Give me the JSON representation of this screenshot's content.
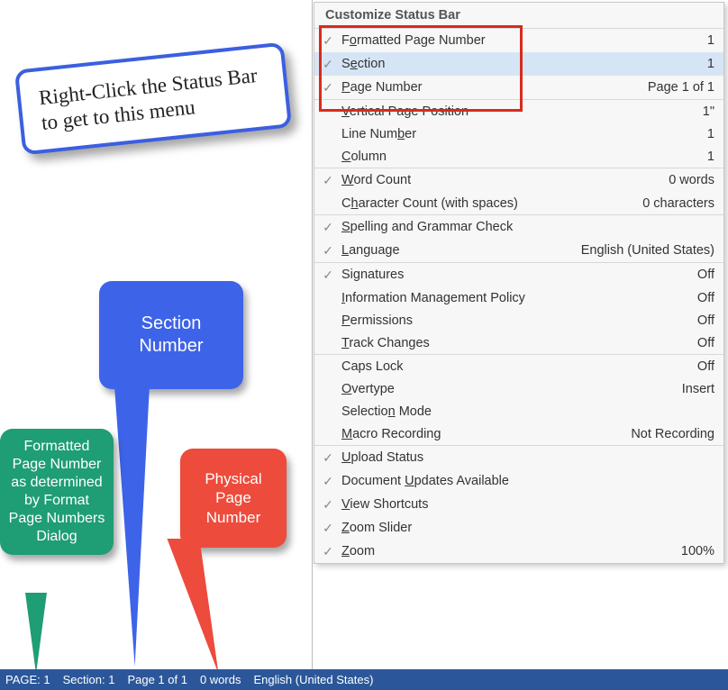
{
  "callout": {
    "note": "Right-Click the Status Bar to get to this menu",
    "blue": "Section Number",
    "green": "Formatted Page Number as determined by Format Page Numbers Dialog",
    "red": "Physical Page Number"
  },
  "menu": {
    "title": "Customize Status Bar",
    "groups": [
      [
        {
          "checked": true,
          "label_pre": "F",
          "label_ul": "o",
          "label_post": "rmatted Page Number",
          "value": "1",
          "hover": false
        },
        {
          "checked": true,
          "label_pre": "S",
          "label_ul": "e",
          "label_post": "ction",
          "value": "1",
          "hover": true
        },
        {
          "checked": true,
          "label_pre": "",
          "label_ul": "P",
          "label_post": "age Number",
          "value": "Page 1 of 1",
          "hover": false
        }
      ],
      [
        {
          "checked": false,
          "label_pre": "",
          "label_ul": "V",
          "label_post": "ertical Page Position",
          "value": "1\""
        },
        {
          "checked": false,
          "label_pre": "Line Num",
          "label_ul": "b",
          "label_post": "er",
          "value": "1"
        },
        {
          "checked": false,
          "label_pre": "",
          "label_ul": "C",
          "label_post": "olumn",
          "value": "1"
        }
      ],
      [
        {
          "checked": true,
          "label_pre": "",
          "label_ul": "W",
          "label_post": "ord Count",
          "value": "0 words"
        },
        {
          "checked": false,
          "label_pre": "C",
          "label_ul": "h",
          "label_post": "aracter Count (with spaces)",
          "value": "0 characters"
        }
      ],
      [
        {
          "checked": true,
          "label_pre": "",
          "label_ul": "S",
          "label_post": "pelling and Grammar Check",
          "value": ""
        },
        {
          "checked": true,
          "label_pre": "",
          "label_ul": "L",
          "label_post": "anguage",
          "value": "English (United States)"
        }
      ],
      [
        {
          "checked": true,
          "label_pre": "Si",
          "label_ul": "g",
          "label_post": "natures",
          "value": "Off"
        },
        {
          "checked": false,
          "label_pre": "",
          "label_ul": "I",
          "label_post": "nformation Management Policy",
          "value": "Off"
        },
        {
          "checked": false,
          "label_pre": "",
          "label_ul": "P",
          "label_post": "ermissions",
          "value": "Off"
        },
        {
          "checked": false,
          "label_pre": "",
          "label_ul": "T",
          "label_post": "rack Changes",
          "value": "Off"
        }
      ],
      [
        {
          "checked": false,
          "label_pre": "Caps Lock",
          "label_ul": "",
          "label_post": "",
          "value": "Off"
        },
        {
          "checked": false,
          "label_pre": "",
          "label_ul": "O",
          "label_post": "vertype",
          "value": "Insert"
        },
        {
          "checked": false,
          "label_pre": "Selectio",
          "label_ul": "n",
          "label_post": " Mode",
          "value": ""
        },
        {
          "checked": false,
          "label_pre": "",
          "label_ul": "M",
          "label_post": "acro Recording",
          "value": "Not Recording"
        }
      ],
      [
        {
          "checked": true,
          "label_pre": "",
          "label_ul": "U",
          "label_post": "pload Status",
          "value": ""
        },
        {
          "checked": true,
          "label_pre": "Document ",
          "label_ul": "U",
          "label_post": "pdates Available",
          "value": ""
        },
        {
          "checked": true,
          "label_pre": "",
          "label_ul": "V",
          "label_post": "iew Shortcuts",
          "value": ""
        },
        {
          "checked": true,
          "label_pre": "",
          "label_ul": "Z",
          "label_post": "oom Slider",
          "value": ""
        },
        {
          "checked": true,
          "label_pre": "",
          "label_ul": "Z",
          "label_post": "oom",
          "value": "100%"
        }
      ]
    ]
  },
  "statusbar": {
    "page": "PAGE: 1",
    "section": "Section: 1",
    "page_of": "Page 1 of 1",
    "words": "0 words",
    "language": "English (United States)"
  }
}
